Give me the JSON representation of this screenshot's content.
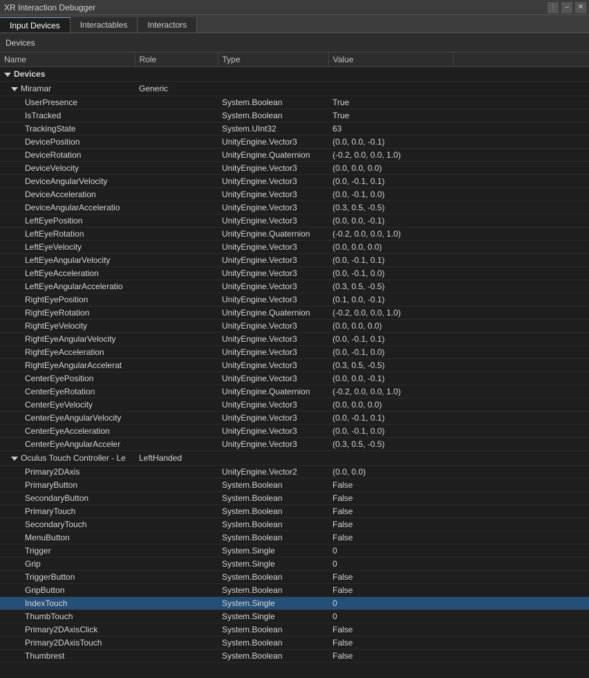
{
  "titleBar": {
    "title": "XR Interaction Debugger",
    "controls": [
      "menu-dots",
      "minimize",
      "close"
    ]
  },
  "tabs": [
    {
      "label": "Input Devices",
      "active": true
    },
    {
      "label": "Interactables",
      "active": false
    },
    {
      "label": "Interactors",
      "active": false
    }
  ],
  "devicesBar": {
    "label": "Devices"
  },
  "tableHeaders": [
    "Name",
    "Role",
    "Type",
    "Value",
    ""
  ],
  "sections": [
    {
      "type": "section",
      "name": "Devices",
      "indent": 0,
      "collapsed": false
    },
    {
      "type": "subsection",
      "name": "Miramar",
      "role": "Generic",
      "indent": 1,
      "collapsed": false
    },
    {
      "type": "row",
      "name": "UserPresence",
      "role": "",
      "dataType": "System.Boolean",
      "value": "True",
      "indent": 2
    },
    {
      "type": "row",
      "name": "IsTracked",
      "role": "",
      "dataType": "System.Boolean",
      "value": "True",
      "indent": 2
    },
    {
      "type": "row",
      "name": "TrackingState",
      "role": "",
      "dataType": "System.UInt32",
      "value": "63",
      "indent": 2
    },
    {
      "type": "row",
      "name": "DevicePosition",
      "role": "",
      "dataType": "UnityEngine.Vector3",
      "value": "(0.0, 0.0, -0.1)",
      "indent": 2
    },
    {
      "type": "row",
      "name": "DeviceRotation",
      "role": "",
      "dataType": "UnityEngine.Quaternion",
      "value": "(-0.2, 0.0, 0.0, 1.0)",
      "indent": 2
    },
    {
      "type": "row",
      "name": "DeviceVelocity",
      "role": "",
      "dataType": "UnityEngine.Vector3",
      "value": "(0.0, 0.0, 0.0)",
      "indent": 2
    },
    {
      "type": "row",
      "name": "DeviceAngularVelocity",
      "role": "",
      "dataType": "UnityEngine.Vector3",
      "value": "(0.0, -0.1, 0.1)",
      "indent": 2
    },
    {
      "type": "row",
      "name": "DeviceAcceleration",
      "role": "",
      "dataType": "UnityEngine.Vector3",
      "value": "(0.0, -0.1, 0.0)",
      "indent": 2
    },
    {
      "type": "row",
      "name": "DeviceAngularAcceleratio",
      "role": "",
      "dataType": "UnityEngine.Vector3",
      "value": "(0.3, 0.5, -0.5)",
      "indent": 2
    },
    {
      "type": "row",
      "name": "LeftEyePosition",
      "role": "",
      "dataType": "UnityEngine.Vector3",
      "value": "(0.0, 0.0, -0.1)",
      "indent": 2
    },
    {
      "type": "row",
      "name": "LeftEyeRotation",
      "role": "",
      "dataType": "UnityEngine.Quaternion",
      "value": "(-0.2, 0.0, 0.0, 1.0)",
      "indent": 2
    },
    {
      "type": "row",
      "name": "LeftEyeVelocity",
      "role": "",
      "dataType": "UnityEngine.Vector3",
      "value": "(0.0, 0.0, 0.0)",
      "indent": 2
    },
    {
      "type": "row",
      "name": "LeftEyeAngularVelocity",
      "role": "",
      "dataType": "UnityEngine.Vector3",
      "value": "(0.0, -0.1, 0.1)",
      "indent": 2
    },
    {
      "type": "row",
      "name": "LeftEyeAcceleration",
      "role": "",
      "dataType": "UnityEngine.Vector3",
      "value": "(0.0, -0.1, 0.0)",
      "indent": 2
    },
    {
      "type": "row",
      "name": "LeftEyeAngularAcceleratio",
      "role": "",
      "dataType": "UnityEngine.Vector3",
      "value": "(0.3, 0.5, -0.5)",
      "indent": 2
    },
    {
      "type": "row",
      "name": "RightEyePosition",
      "role": "",
      "dataType": "UnityEngine.Vector3",
      "value": "(0.1, 0.0, -0.1)",
      "indent": 2
    },
    {
      "type": "row",
      "name": "RightEyeRotation",
      "role": "",
      "dataType": "UnityEngine.Quaternion",
      "value": "(-0.2, 0.0, 0.0, 1.0)",
      "indent": 2
    },
    {
      "type": "row",
      "name": "RightEyeVelocity",
      "role": "",
      "dataType": "UnityEngine.Vector3",
      "value": "(0.0, 0.0, 0.0)",
      "indent": 2
    },
    {
      "type": "row",
      "name": "RightEyeAngularVelocity",
      "role": "",
      "dataType": "UnityEngine.Vector3",
      "value": "(0.0, -0.1, 0.1)",
      "indent": 2
    },
    {
      "type": "row",
      "name": "RightEyeAcceleration",
      "role": "",
      "dataType": "UnityEngine.Vector3",
      "value": "(0.0, -0.1, 0.0)",
      "indent": 2
    },
    {
      "type": "row",
      "name": "RightEyeAngularAccelerat",
      "role": "",
      "dataType": "UnityEngine.Vector3",
      "value": "(0.3, 0.5, -0.5)",
      "indent": 2
    },
    {
      "type": "row",
      "name": "CenterEyePosition",
      "role": "",
      "dataType": "UnityEngine.Vector3",
      "value": "(0.0, 0.0, -0.1)",
      "indent": 2
    },
    {
      "type": "row",
      "name": "CenterEyeRotation",
      "role": "",
      "dataType": "UnityEngine.Quaternion",
      "value": "(-0.2, 0.0, 0.0, 1.0)",
      "indent": 2
    },
    {
      "type": "row",
      "name": "CenterEyeVelocity",
      "role": "",
      "dataType": "UnityEngine.Vector3",
      "value": "(0.0, 0.0, 0.0)",
      "indent": 2
    },
    {
      "type": "row",
      "name": "CenterEyeAngularVelocity",
      "role": "",
      "dataType": "UnityEngine.Vector3",
      "value": "(0.0, -0.1, 0.1)",
      "indent": 2
    },
    {
      "type": "row",
      "name": "CenterEyeAcceleration",
      "role": "",
      "dataType": "UnityEngine.Vector3",
      "value": "(0.0, -0.1, 0.0)",
      "indent": 2
    },
    {
      "type": "row",
      "name": "CenterEyeAngularAcceler",
      "role": "",
      "dataType": "UnityEngine.Vector3",
      "value": "(0.3, 0.5, -0.5)",
      "indent": 2
    },
    {
      "type": "subsection",
      "name": "Oculus Touch Controller - Le",
      "role": "LeftHanded",
      "indent": 1,
      "collapsed": false
    },
    {
      "type": "row",
      "name": "Primary2DAxis",
      "role": "",
      "dataType": "UnityEngine.Vector2",
      "value": "(0.0, 0.0)",
      "indent": 2
    },
    {
      "type": "row",
      "name": "PrimaryButton",
      "role": "",
      "dataType": "System.Boolean",
      "value": "False",
      "indent": 2
    },
    {
      "type": "row",
      "name": "SecondaryButton",
      "role": "",
      "dataType": "System.Boolean",
      "value": "False",
      "indent": 2
    },
    {
      "type": "row",
      "name": "PrimaryTouch",
      "role": "",
      "dataType": "System.Boolean",
      "value": "False",
      "indent": 2
    },
    {
      "type": "row",
      "name": "SecondaryTouch",
      "role": "",
      "dataType": "System.Boolean",
      "value": "False",
      "indent": 2
    },
    {
      "type": "row",
      "name": "MenuButton",
      "role": "",
      "dataType": "System.Boolean",
      "value": "False",
      "indent": 2
    },
    {
      "type": "row",
      "name": "Trigger",
      "role": "",
      "dataType": "System.Single",
      "value": "0",
      "indent": 2
    },
    {
      "type": "row",
      "name": "Grip",
      "role": "",
      "dataType": "System.Single",
      "value": "0",
      "indent": 2
    },
    {
      "type": "row",
      "name": "TriggerButton",
      "role": "",
      "dataType": "System.Boolean",
      "value": "False",
      "indent": 2
    },
    {
      "type": "row",
      "name": "GripButton",
      "role": "",
      "dataType": "System.Boolean",
      "value": "False",
      "indent": 2
    },
    {
      "type": "row",
      "name": "IndexTouch",
      "role": "",
      "dataType": "System.Single",
      "value": "0",
      "indent": 2,
      "selected": true
    },
    {
      "type": "row",
      "name": "ThumbTouch",
      "role": "",
      "dataType": "System.Single",
      "value": "0",
      "indent": 2
    },
    {
      "type": "row",
      "name": "Primary2DAxisClick",
      "role": "",
      "dataType": "System.Boolean",
      "value": "False",
      "indent": 2
    },
    {
      "type": "row",
      "name": "Primary2DAxisTouch",
      "role": "",
      "dataType": "System.Boolean",
      "value": "False",
      "indent": 2
    },
    {
      "type": "row",
      "name": "Thumbrest",
      "role": "",
      "dataType": "System.Boolean",
      "value": "False",
      "indent": 2
    }
  ]
}
